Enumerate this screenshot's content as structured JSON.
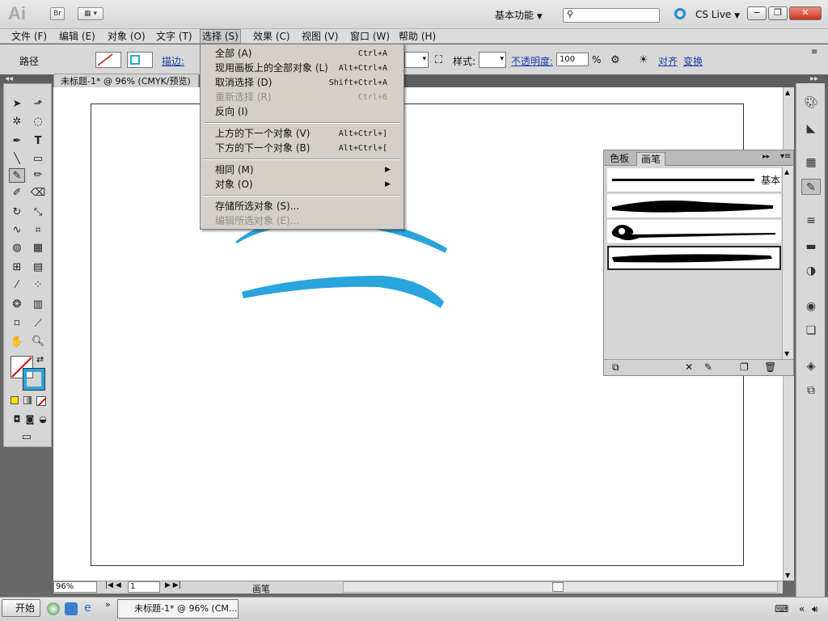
{
  "app": {
    "logo": "Ai",
    "bridge": "Br",
    "workspace": "基本功能",
    "cs_live": "CS Live"
  },
  "window_controls": {
    "minimize": "−",
    "restore": "❐",
    "close": "✕"
  },
  "menubar": [
    {
      "label": "文件 (F)"
    },
    {
      "label": "编辑 (E)"
    },
    {
      "label": "对象 (O)"
    },
    {
      "label": "文字 (T)"
    },
    {
      "label": "选择 (S)"
    },
    {
      "label": "效果 (C)"
    },
    {
      "label": "视图 (V)"
    },
    {
      "label": "窗口 (W)"
    },
    {
      "label": "帮助 (H)"
    }
  ],
  "control_bar": {
    "object_type": "路径",
    "stroke_label": "描边:",
    "style_label": "样式:",
    "opacity_label": "不透明度:",
    "opacity_value": "100",
    "opacity_unit": "%",
    "align_link": "对齐",
    "transform_link": "变换"
  },
  "document": {
    "tab_title": "未标题-1* @ 96% (CMYK/预览)"
  },
  "select_menu": [
    {
      "label": "全部 (A)",
      "shortcut": "Ctrl+A",
      "disabled": false
    },
    {
      "label": "现用画板上的全部对象 (L)",
      "shortcut": "Alt+Ctrl+A",
      "disabled": false
    },
    {
      "label": "取消选择 (D)",
      "shortcut": "Shift+Ctrl+A",
      "disabled": false
    },
    {
      "label": "重新选择 (R)",
      "shortcut": "Ctrl+6",
      "disabled": true
    },
    {
      "label": "反向 (I)",
      "shortcut": "",
      "disabled": false
    },
    {
      "label": "上方的下一个对象 (V)",
      "shortcut": "Alt+Ctrl+]",
      "disabled": false
    },
    {
      "label": "下方的下一个对象 (B)",
      "shortcut": "Alt+Ctrl+[",
      "disabled": false
    },
    {
      "label": "相同 (M)",
      "shortcut": "",
      "disabled": false
    },
    {
      "label": "对象 (O)",
      "shortcut": "",
      "disabled": false
    },
    {
      "label": "存储所选对象 (S)...",
      "shortcut": "",
      "disabled": false
    },
    {
      "label": "编辑所选对象 (E)...",
      "shortcut": "",
      "disabled": true
    }
  ],
  "brush_panel": {
    "tabs": [
      "色板",
      "画笔"
    ],
    "basic_label": "基本"
  },
  "status": {
    "zoom": "96%",
    "artboard": "1",
    "tool_name": "画笔"
  },
  "taskbar": {
    "start": "开始",
    "item": "未标题-1* @ 96% (CM..."
  },
  "colors": {
    "stroke_blue": "#2aa4dc",
    "accent": "#1a3ca8"
  }
}
